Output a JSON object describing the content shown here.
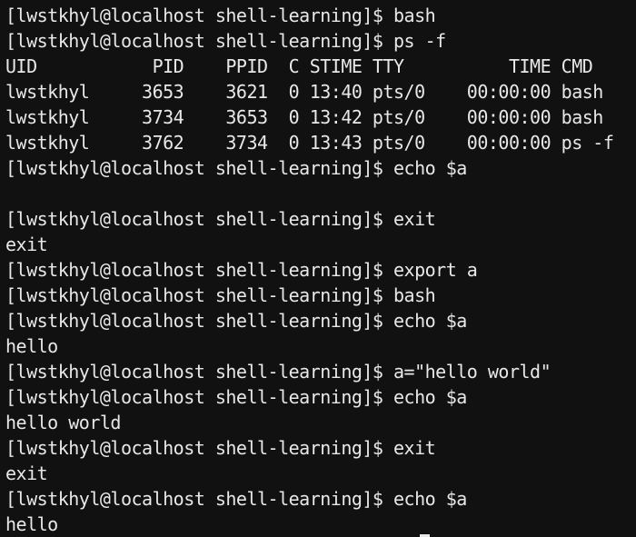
{
  "terminal": {
    "background": "#111111",
    "foreground": "#e8e8e8",
    "lines": [
      "[lwstkhyl@localhost shell-learning]$ bash",
      "[lwstkhyl@localhost shell-learning]$ ps -f",
      "UID           PID    PPID  C STIME TTY          TIME CMD",
      "lwstkhyl     3653    3621  0 13:40 pts/0    00:00:00 bash",
      "lwstkhyl     3734    3653  0 13:42 pts/0    00:00:00 bash",
      "lwstkhyl     3762    3734  0 13:43 pts/0    00:00:00 ps -f",
      "[lwstkhyl@localhost shell-learning]$ echo $a",
      "",
      "[lwstkhyl@localhost shell-learning]$ exit",
      "exit",
      "[lwstkhyl@localhost shell-learning]$ export a",
      "[lwstkhyl@localhost shell-learning]$ bash",
      "[lwstkhyl@localhost shell-learning]$ echo $a",
      "hello",
      "[lwstkhyl@localhost shell-learning]$ a=\"hello world\"",
      "[lwstkhyl@localhost shell-learning]$ echo $a",
      "hello world",
      "[lwstkhyl@localhost shell-learning]$ exit",
      "exit",
      "[lwstkhyl@localhost shell-learning]$ echo $a",
      "hello"
    ]
  }
}
